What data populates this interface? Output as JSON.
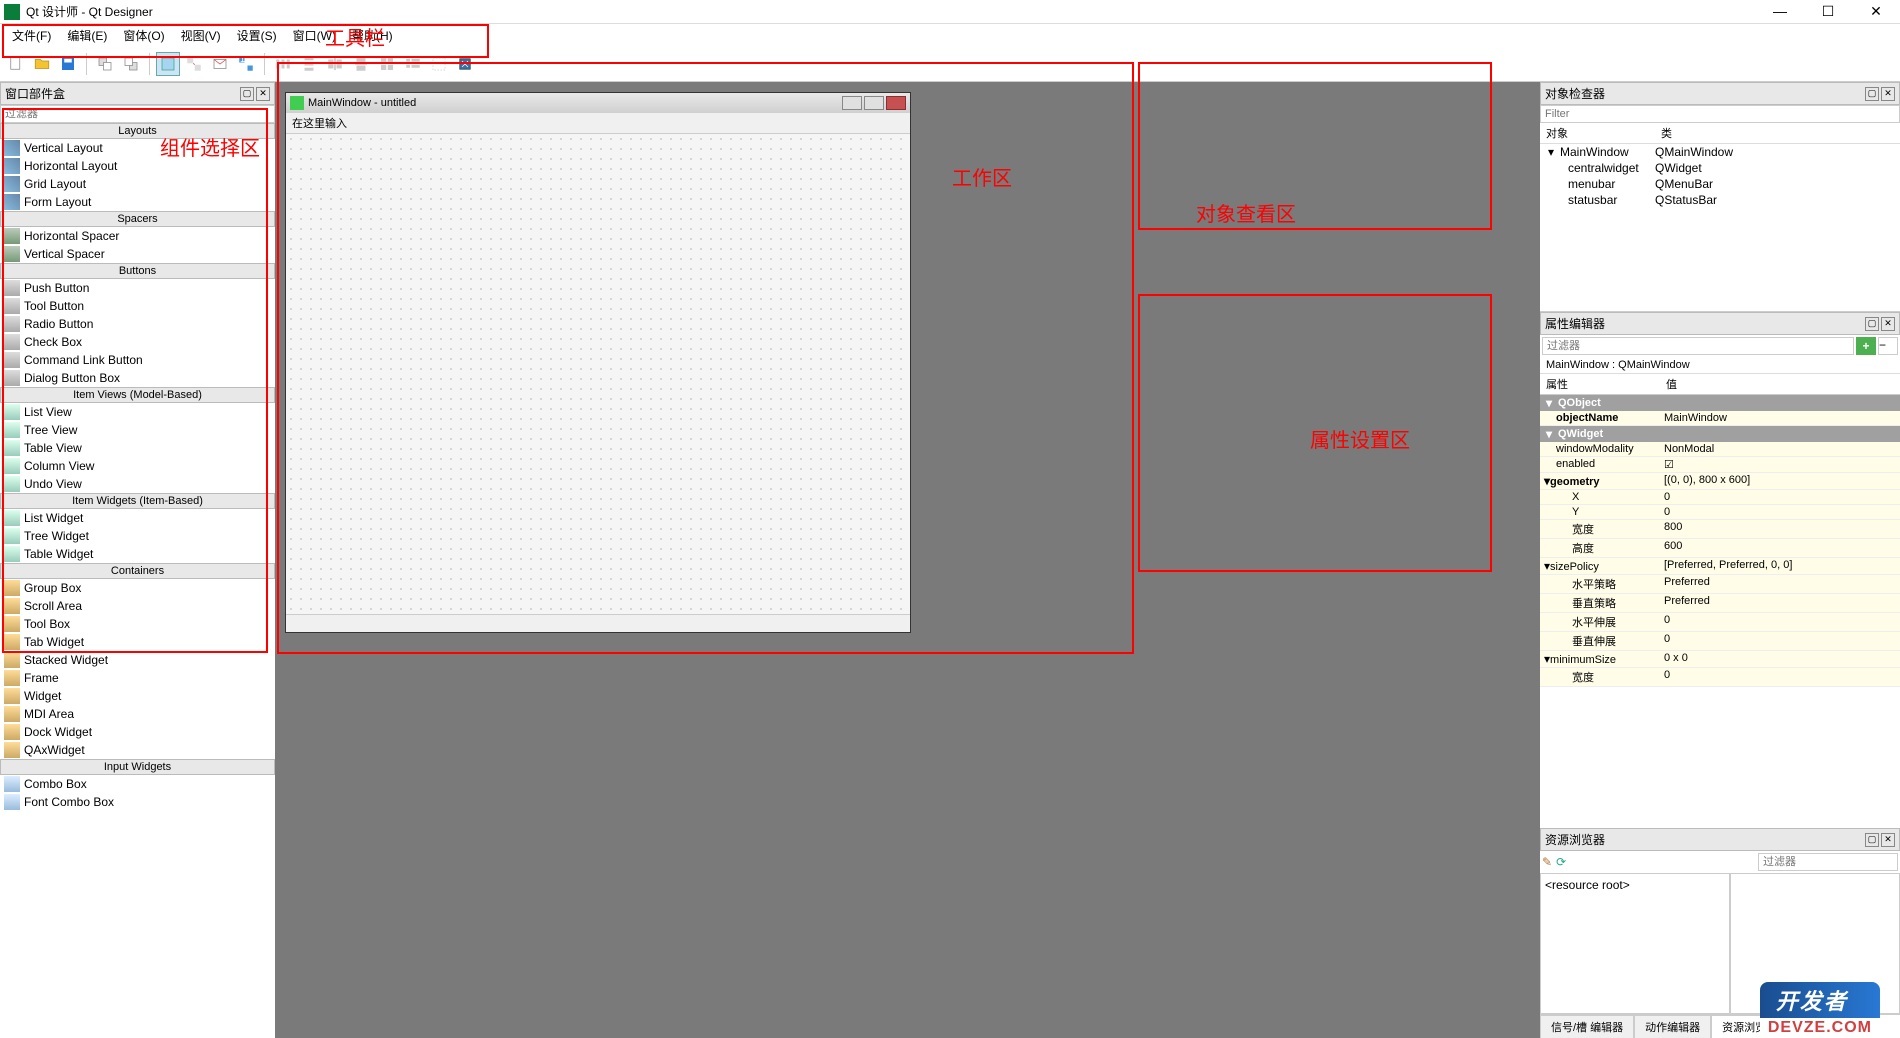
{
  "app": {
    "title": "Qt 设计师 - Qt Designer"
  },
  "menu": {
    "items": [
      "文件(F)",
      "编辑(E)",
      "窗体(O)",
      "视图(V)",
      "设置(S)",
      "窗口(W)",
      "帮助(H)"
    ]
  },
  "annotations": {
    "toolbar": "工具栏",
    "widget_area": "组件选择区",
    "work_area": "工作区",
    "object_area": "对象查看区",
    "property_area": "属性设置区"
  },
  "widget_box": {
    "title": "窗口部件盒",
    "filter": "过滤器",
    "categories": [
      {
        "name": "Layouts",
        "items": [
          "Vertical Layout",
          "Horizontal Layout",
          "Grid Layout",
          "Form Layout"
        ],
        "iconClass": "icon-layout"
      },
      {
        "name": "Spacers",
        "items": [
          "Horizontal Spacer",
          "Vertical Spacer"
        ],
        "iconClass": "icon-spacer"
      },
      {
        "name": "Buttons",
        "items": [
          "Push Button",
          "Tool Button",
          "Radio Button",
          "Check Box",
          "Command Link Button",
          "Dialog Button Box"
        ],
        "iconClass": "icon-btn"
      },
      {
        "name": "Item Views (Model-Based)",
        "items": [
          "List View",
          "Tree View",
          "Table View",
          "Column View",
          "Undo View"
        ],
        "iconClass": "icon-view"
      },
      {
        "name": "Item Widgets (Item-Based)",
        "items": [
          "List Widget",
          "Tree Widget",
          "Table Widget"
        ],
        "iconClass": "icon-view"
      },
      {
        "name": "Containers",
        "items": [
          "Group Box",
          "Scroll Area",
          "Tool Box",
          "Tab Widget",
          "Stacked Widget",
          "Frame",
          "Widget",
          "MDI Area",
          "Dock Widget",
          "QAxWidget"
        ],
        "iconClass": "icon-container"
      },
      {
        "name": "Input Widgets",
        "items": [
          "Combo Box",
          "Font Combo Box"
        ],
        "iconClass": "icon-input"
      }
    ]
  },
  "design_window": {
    "title": "MainWindow - untitled",
    "menu_text": "在这里输入"
  },
  "object_inspector": {
    "title": "对象检查器",
    "filter": "Filter",
    "headers": {
      "object": "对象",
      "class": "类"
    },
    "rows": [
      {
        "name": "MainWindow",
        "class": "QMainWindow",
        "indent": 0,
        "expand": true
      },
      {
        "name": "centralwidget",
        "class": "QWidget",
        "indent": 1
      },
      {
        "name": "menubar",
        "class": "QMenuBar",
        "indent": 1
      },
      {
        "name": "statusbar",
        "class": "QStatusBar",
        "indent": 1
      }
    ]
  },
  "property_editor": {
    "title": "属性编辑器",
    "filter": "过滤器",
    "context": "MainWindow : QMainWindow",
    "headers": {
      "prop": "属性",
      "value": "值"
    },
    "groups": [
      {
        "name": "QObject",
        "rows": [
          {
            "name": "objectName",
            "value": "MainWindow",
            "bold": true
          }
        ]
      },
      {
        "name": "QWidget",
        "rows": [
          {
            "name": "windowModality",
            "value": "NonModal"
          },
          {
            "name": "enabled",
            "value": "☑"
          },
          {
            "name": "geometry",
            "value": "[(0, 0), 800 x 600]",
            "bold": true,
            "expand": true
          },
          {
            "name": "X",
            "value": "0",
            "sub": true
          },
          {
            "name": "Y",
            "value": "0",
            "sub": true
          },
          {
            "name": "宽度",
            "value": "800",
            "sub": true
          },
          {
            "name": "高度",
            "value": "600",
            "sub": true
          },
          {
            "name": "sizePolicy",
            "value": "[Preferred, Preferred, 0, 0]",
            "expand": true
          },
          {
            "name": "水平策略",
            "value": "Preferred",
            "sub": true
          },
          {
            "name": "垂直策略",
            "value": "Preferred",
            "sub": true
          },
          {
            "name": "水平伸展",
            "value": "0",
            "sub": true
          },
          {
            "name": "垂直伸展",
            "value": "0",
            "sub": true
          },
          {
            "name": "minimumSize",
            "value": "0 x 0",
            "expand": true
          },
          {
            "name": "宽度",
            "value": "0",
            "sub": true
          }
        ]
      }
    ]
  },
  "resource_browser": {
    "title": "资源浏览器",
    "filter": "过滤器",
    "root": "<resource root>",
    "tabs": [
      "信号/槽 编辑器",
      "动作编辑器",
      "资源浏览器"
    ],
    "active_tab": 2
  },
  "watermark": {
    "top": "开发者",
    "bottom": "DEVZE.COM"
  }
}
